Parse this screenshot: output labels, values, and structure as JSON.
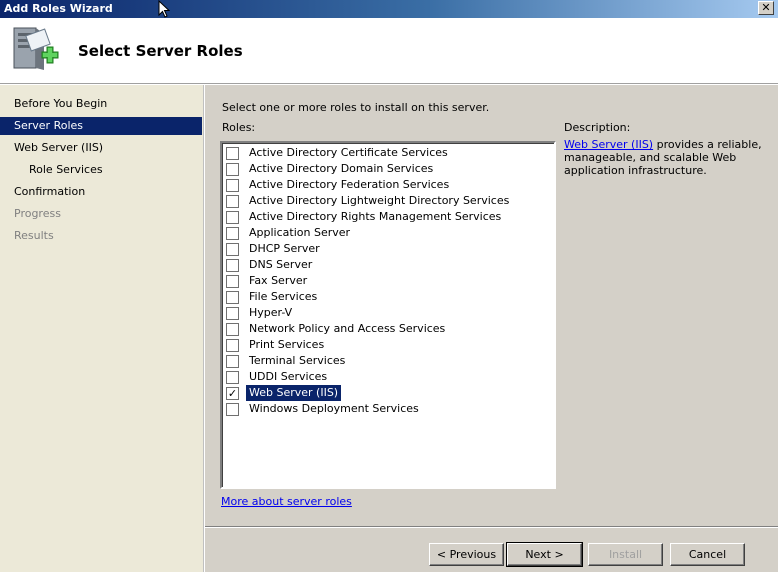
{
  "window": {
    "title": "Add Roles Wizard",
    "close_label": "✕"
  },
  "header": {
    "title": "Select Server Roles"
  },
  "sidebar": {
    "items": [
      {
        "label": "Before You Begin",
        "state": "normal"
      },
      {
        "label": "Server Roles",
        "state": "selected"
      },
      {
        "label": "Web Server (IIS)",
        "state": "normal"
      },
      {
        "label": "Role Services",
        "state": "sub"
      },
      {
        "label": "Confirmation",
        "state": "normal"
      },
      {
        "label": "Progress",
        "state": "disabled"
      },
      {
        "label": "Results",
        "state": "disabled"
      }
    ]
  },
  "main": {
    "instruction": "Select one or more roles to install on this server.",
    "roles_label": "Roles:",
    "roles": [
      {
        "label": "Active Directory Certificate Services",
        "checked": false
      },
      {
        "label": "Active Directory Domain Services",
        "checked": false
      },
      {
        "label": "Active Directory Federation Services",
        "checked": false
      },
      {
        "label": "Active Directory Lightweight Directory Services",
        "checked": false
      },
      {
        "label": "Active Directory Rights Management Services",
        "checked": false
      },
      {
        "label": "Application Server",
        "checked": false
      },
      {
        "label": "DHCP Server",
        "checked": false
      },
      {
        "label": "DNS Server",
        "checked": false
      },
      {
        "label": "Fax Server",
        "checked": false
      },
      {
        "label": "File Services",
        "checked": false
      },
      {
        "label": "Hyper-V",
        "checked": false
      },
      {
        "label": "Network Policy and Access Services",
        "checked": false
      },
      {
        "label": "Print Services",
        "checked": false
      },
      {
        "label": "Terminal Services",
        "checked": false
      },
      {
        "label": "UDDI Services",
        "checked": false
      },
      {
        "label": "Web Server (IIS)",
        "checked": true
      },
      {
        "label": "Windows Deployment Services",
        "checked": false
      }
    ],
    "description_label": "Description:",
    "description_link": "Web Server (IIS)",
    "description_text": " provides a reliable, manageable, and scalable Web application infrastructure.",
    "more_link": "More about server roles"
  },
  "buttons": {
    "previous": "< Previous",
    "next": "Next >",
    "install": "Install",
    "cancel": "Cancel"
  },
  "colors": {
    "selection": "#0a246a",
    "dialog_face": "#d4d0c8",
    "link": "#0000ee"
  }
}
